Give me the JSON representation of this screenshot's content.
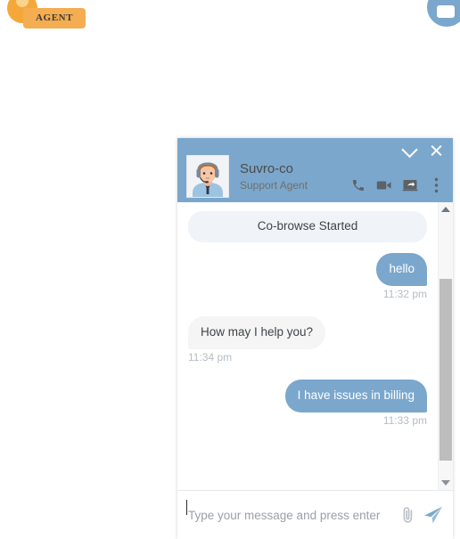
{
  "page": {
    "background_color": "#ffffff"
  },
  "agent_badge": {
    "label": "AGENT",
    "pill_color": "#f4ad50",
    "dot_color": "#f5a83a"
  },
  "launcher": {
    "icon": "chat-bubble-icon",
    "color": "#7ba7cc"
  },
  "chat_widget": {
    "accent_color": "#7ba7cc",
    "header": {
      "agent_name": "Suvro-co",
      "agent_role": "Support Agent",
      "avatar_icon": "support-agent-avatar",
      "window_controls": [
        {
          "name": "minimize-button",
          "icon": "chevron-down-icon"
        },
        {
          "name": "close-button",
          "icon": "close-icon"
        }
      ],
      "actions": [
        {
          "name": "voice-call-button",
          "icon": "phone-icon"
        },
        {
          "name": "video-call-button",
          "icon": "video-camera-icon"
        },
        {
          "name": "screen-share-button",
          "icon": "screen-share-icon"
        },
        {
          "name": "more-options-button",
          "icon": "kebab-menu-icon"
        }
      ]
    },
    "messages": [
      {
        "type": "system",
        "text": "Co-browse Started",
        "time": ""
      },
      {
        "type": "user",
        "text": "hello",
        "time": "11:32 pm"
      },
      {
        "type": "agent",
        "text": "How may I help you?",
        "time": "11:34 pm"
      },
      {
        "type": "user",
        "text": "I have issues in billing",
        "time": "11:33 pm"
      }
    ],
    "scrollbar": {
      "up_icon": "scroll-up-arrow-icon",
      "down_icon": "scroll-down-arrow-icon",
      "thumb_color": "#bdbdbd"
    },
    "composer": {
      "placeholder": "Type your message and press enter",
      "value": "",
      "attach_icon": "paperclip-icon",
      "send_icon": "send-paper-plane-icon"
    }
  }
}
